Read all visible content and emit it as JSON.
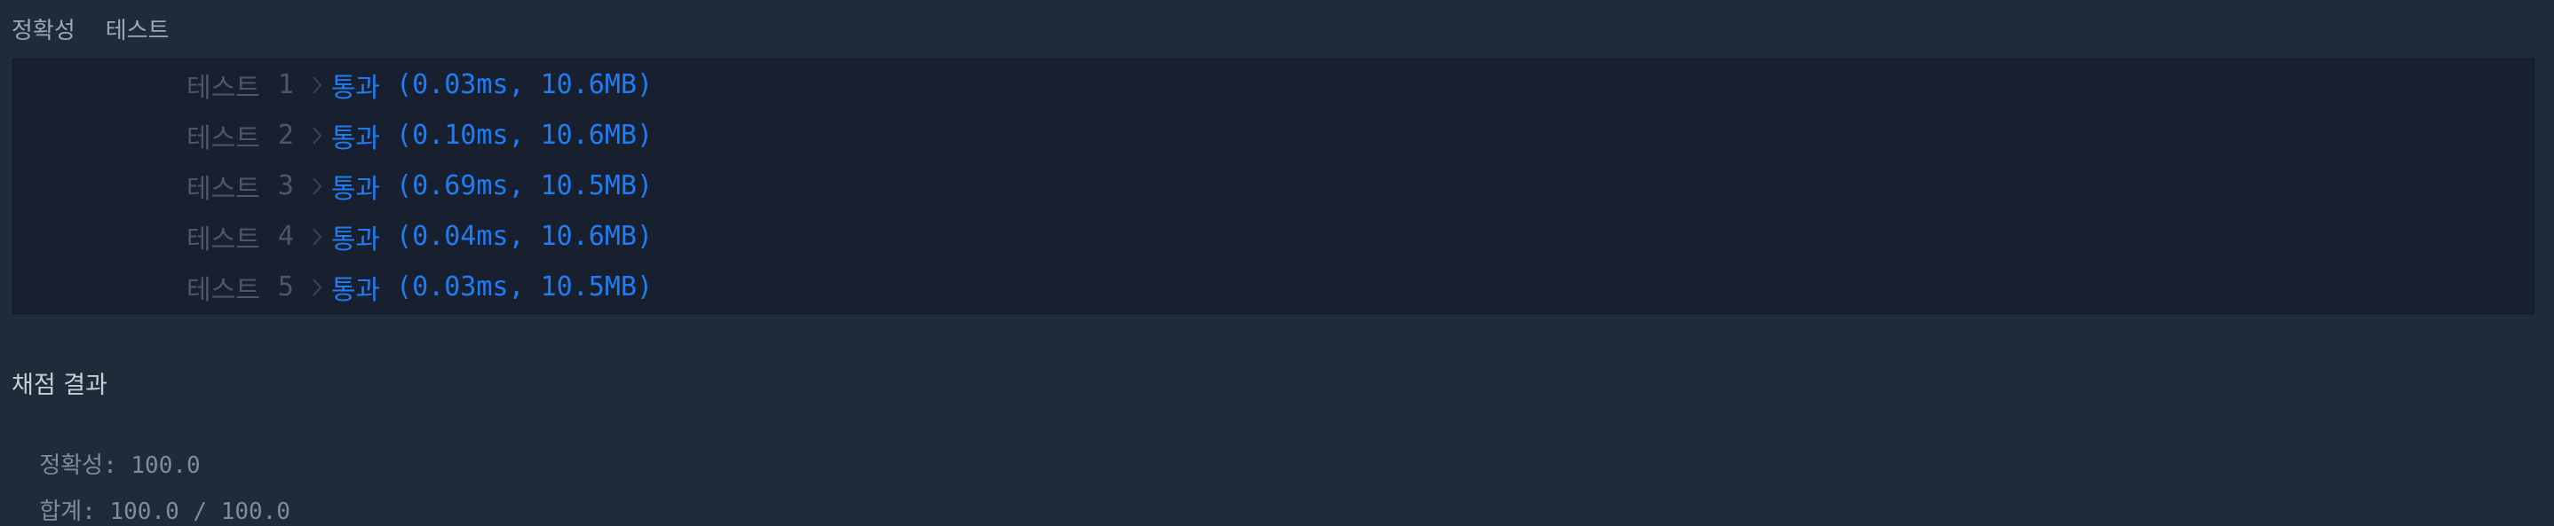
{
  "tabs": {
    "accuracy_label": "정확성",
    "test_label": "테스트"
  },
  "tests": [
    {
      "label": "테스트",
      "number": "1",
      "status": "통과",
      "result": "(0.03ms, 10.6MB)"
    },
    {
      "label": "테스트",
      "number": "2",
      "status": "통과",
      "result": "(0.10ms, 10.6MB)"
    },
    {
      "label": "테스트",
      "number": "3",
      "status": "통과",
      "result": "(0.69ms, 10.5MB)"
    },
    {
      "label": "테스트",
      "number": "4",
      "status": "통과",
      "result": "(0.04ms, 10.6MB)"
    },
    {
      "label": "테스트",
      "number": "5",
      "status": "통과",
      "result": "(0.03ms, 10.5MB)"
    }
  ],
  "summary": {
    "title": "채점 결과",
    "accuracy_key": "정확성",
    "accuracy_value": ": 100.0",
    "total_key": "합계",
    "total_value": ": 100.0 / 100.0"
  },
  "colors": {
    "background": "#1f2b39",
    "panel": "#182030",
    "pass": "#1f7cf2",
    "muted": "#4b5767"
  },
  "icons": [
    "chevron-right-icon"
  ]
}
